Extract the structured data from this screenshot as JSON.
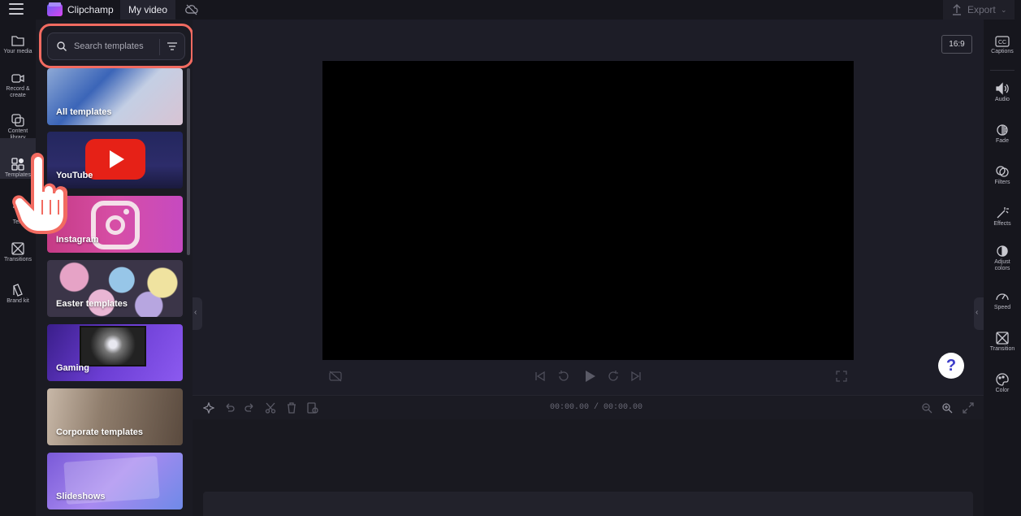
{
  "app": {
    "brand": "Clipchamp",
    "video_title": "My video",
    "export_label": "Export"
  },
  "left_rail": [
    {
      "label": "Your media",
      "icon": "folder-icon"
    },
    {
      "label": "Record & create",
      "icon": "camera-icon"
    },
    {
      "label": "Content library",
      "icon": "library-icon"
    },
    {
      "label": "Templates",
      "icon": "templates-icon",
      "active": true
    },
    {
      "label": "Text",
      "icon": "text-icon"
    },
    {
      "label": "Transitions",
      "icon": "transitions-icon"
    },
    {
      "label": "Brand kit",
      "icon": "brand-kit-icon"
    }
  ],
  "search": {
    "placeholder": "Search templates"
  },
  "template_categories": [
    {
      "label": "All templates"
    },
    {
      "label": "YouTube"
    },
    {
      "label": "Instagram"
    },
    {
      "label": "Easter templates"
    },
    {
      "label": "Gaming"
    },
    {
      "label": "Corporate templates"
    },
    {
      "label": "Slideshows"
    }
  ],
  "preview": {
    "aspect_ratio": "16:9",
    "help": "?"
  },
  "timeline": {
    "timecode": "00:00.00 / 00:00.00"
  },
  "right_rail": [
    {
      "label": "Captions",
      "icon": "captions-icon"
    },
    {
      "label": "Audio",
      "icon": "audio-icon"
    },
    {
      "label": "Fade",
      "icon": "fade-icon"
    },
    {
      "label": "Filters",
      "icon": "filters-icon"
    },
    {
      "label": "Effects",
      "icon": "effects-icon"
    },
    {
      "label": "Adjust colors",
      "icon": "adjust-colors-icon"
    },
    {
      "label": "Speed",
      "icon": "speed-icon"
    },
    {
      "label": "Transition",
      "icon": "transition-icon"
    },
    {
      "label": "Color",
      "icon": "color-icon"
    }
  ],
  "colors": {
    "highlight": "#f26b61",
    "background": "#1d1d27",
    "accent": "#3a3ac8"
  }
}
